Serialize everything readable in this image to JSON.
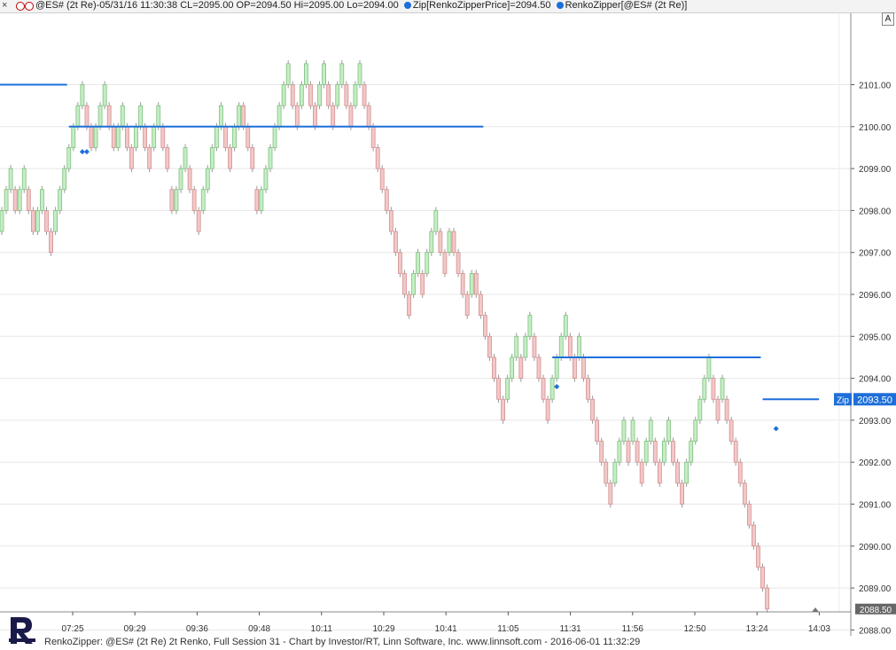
{
  "header": {
    "close_glyph": "×",
    "text": "@ES# (2t Re)-05/31/16 11:30:38 CL=2095.00 OP=2094.50 Hi=2095.00 Lo=2094.00",
    "indicator1": "Zip[RenkoZipperPrice]=2094.50",
    "indicator2": "RenkoZipper[@ES# (2t Re)]"
  },
  "scale_button": "A",
  "footer": {
    "text": "RenkoZipper: @ES# (2t Re) 2t Renko, Full Session 31 - Chart by Investor/RT, Linn Software, Inc. www.linnsoft.com - 2016-06-01 11:32:29"
  },
  "colors": {
    "up_fill": "#c5eec5",
    "up_border": "#7fbf7f",
    "down_fill": "#f2c8c8",
    "down_border": "#d48f8f",
    "zip_line": "#1e6fd9",
    "grid": "#e8e8e8",
    "label_bg": "#1e6fd9"
  },
  "chart_data": {
    "type": "candlestick-renko",
    "brick_size": 0.5,
    "ylim": [
      2087.8,
      2101.5
    ],
    "y_ticks": [
      "2101.00",
      "2100.00",
      "2099.00",
      "2098.00",
      "2097.00",
      "2096.00",
      "2095.00",
      "2094.00",
      "2093.00",
      "2092.00",
      "2091.00",
      "2090.00",
      "2089.00",
      "2088.00"
    ],
    "x_ticks": [
      "07:25",
      "09:29",
      "09:36",
      "09:48",
      "10:11",
      "10:29",
      "10:41",
      "11:05",
      "11:31",
      "11:56",
      "12:50",
      "13:24",
      "14:03"
    ],
    "last_price_label": "2088.50",
    "zip": {
      "name": "Zip",
      "value": "2093.50"
    },
    "bricks": [
      {
        "o": 2097.5,
        "c": 2098.0
      },
      {
        "o": 2098.0,
        "c": 2098.5
      },
      {
        "o": 2098.5,
        "c": 2099.0
      },
      {
        "o": 2098.5,
        "c": 2098.0
      },
      {
        "o": 2098.0,
        "c": 2098.5
      },
      {
        "o": 2098.5,
        "c": 2099.0
      },
      {
        "o": 2098.5,
        "c": 2098.0
      },
      {
        "o": 2098.0,
        "c": 2097.5
      },
      {
        "o": 2097.5,
        "c": 2098.0
      },
      {
        "o": 2098.0,
        "c": 2098.5
      },
      {
        "o": 2098.0,
        "c": 2097.5
      },
      {
        "o": 2097.5,
        "c": 2097.0
      },
      {
        "o": 2097.5,
        "c": 2098.0
      },
      {
        "o": 2098.0,
        "c": 2098.5
      },
      {
        "o": 2098.5,
        "c": 2099.0
      },
      {
        "o": 2099.0,
        "c": 2099.5
      },
      {
        "o": 2099.5,
        "c": 2100.0
      },
      {
        "o": 2100.0,
        "c": 2100.5
      },
      {
        "o": 2100.5,
        "c": 2101.0
      },
      {
        "o": 2100.5,
        "c": 2100.0
      },
      {
        "o": 2100.0,
        "c": 2099.5
      },
      {
        "o": 2099.5,
        "c": 2100.0
      },
      {
        "o": 2100.0,
        "c": 2100.5
      },
      {
        "o": 2100.5,
        "c": 2101.0
      },
      {
        "o": 2100.5,
        "c": 2100.0
      },
      {
        "o": 2100.0,
        "c": 2099.5
      },
      {
        "o": 2099.5,
        "c": 2100.0
      },
      {
        "o": 2100.0,
        "c": 2100.5
      },
      {
        "o": 2100.0,
        "c": 2099.5
      },
      {
        "o": 2099.5,
        "c": 2099.0
      },
      {
        "o": 2099.5,
        "c": 2100.0
      },
      {
        "o": 2100.0,
        "c": 2100.5
      },
      {
        "o": 2100.0,
        "c": 2099.5
      },
      {
        "o": 2099.5,
        "c": 2099.0
      },
      {
        "o": 2099.5,
        "c": 2100.0
      },
      {
        "o": 2100.0,
        "c": 2100.5
      },
      {
        "o": 2100.0,
        "c": 2099.5
      },
      {
        "o": 2099.5,
        "c": 2099.0
      },
      {
        "o": 2098.5,
        "c": 2098.0
      },
      {
        "o": 2098.0,
        "c": 2098.5
      },
      {
        "o": 2098.5,
        "c": 2099.0
      },
      {
        "o": 2099.0,
        "c": 2099.5
      },
      {
        "o": 2099.0,
        "c": 2098.5
      },
      {
        "o": 2098.5,
        "c": 2098.0
      },
      {
        "o": 2098.0,
        "c": 2097.5
      },
      {
        "o": 2098.0,
        "c": 2098.5
      },
      {
        "o": 2098.5,
        "c": 2099.0
      },
      {
        "o": 2099.0,
        "c": 2099.5
      },
      {
        "o": 2099.5,
        "c": 2100.0
      },
      {
        "o": 2100.0,
        "c": 2100.5
      },
      {
        "o": 2100.0,
        "c": 2099.5
      },
      {
        "o": 2099.5,
        "c": 2099.0
      },
      {
        "o": 2099.5,
        "c": 2100.0
      },
      {
        "o": 2100.0,
        "c": 2100.5
      },
      {
        "o": 2100.5,
        "c": 2100.0
      },
      {
        "o": 2100.0,
        "c": 2099.5
      },
      {
        "o": 2099.5,
        "c": 2099.0
      },
      {
        "o": 2098.5,
        "c": 2098.0
      },
      {
        "o": 2098.0,
        "c": 2098.5
      },
      {
        "o": 2098.5,
        "c": 2099.0
      },
      {
        "o": 2099.0,
        "c": 2099.5
      },
      {
        "o": 2099.5,
        "c": 2100.0
      },
      {
        "o": 2100.0,
        "c": 2100.5
      },
      {
        "o": 2100.5,
        "c": 2101.0
      },
      {
        "o": 2101.0,
        "c": 2101.5
      },
      {
        "o": 2101.0,
        "c": 2100.5
      },
      {
        "o": 2100.5,
        "c": 2100.0
      },
      {
        "o": 2100.5,
        "c": 2101.0
      },
      {
        "o": 2101.0,
        "c": 2101.5
      },
      {
        "o": 2101.0,
        "c": 2100.5
      },
      {
        "o": 2100.5,
        "c": 2100.0
      },
      {
        "o": 2100.5,
        "c": 2101.0
      },
      {
        "o": 2101.0,
        "c": 2101.5
      },
      {
        "o": 2101.0,
        "c": 2100.5
      },
      {
        "o": 2100.5,
        "c": 2100.0
      },
      {
        "o": 2100.5,
        "c": 2101.0
      },
      {
        "o": 2101.0,
        "c": 2101.5
      },
      {
        "o": 2101.0,
        "c": 2100.5
      },
      {
        "o": 2100.5,
        "c": 2100.0
      },
      {
        "o": 2100.5,
        "c": 2101.0
      },
      {
        "o": 2101.0,
        "c": 2101.5
      },
      {
        "o": 2101.0,
        "c": 2100.5
      },
      {
        "o": 2100.5,
        "c": 2100.0
      },
      {
        "o": 2100.0,
        "c": 2099.5
      },
      {
        "o": 2099.5,
        "c": 2099.0
      },
      {
        "o": 2099.0,
        "c": 2098.5
      },
      {
        "o": 2098.5,
        "c": 2098.0
      },
      {
        "o": 2098.0,
        "c": 2097.5
      },
      {
        "o": 2097.5,
        "c": 2097.0
      },
      {
        "o": 2097.0,
        "c": 2096.5
      },
      {
        "o": 2096.5,
        "c": 2096.0
      },
      {
        "o": 2096.0,
        "c": 2095.5
      },
      {
        "o": 2096.0,
        "c": 2096.5
      },
      {
        "o": 2096.5,
        "c": 2097.0
      },
      {
        "o": 2096.5,
        "c": 2096.0
      },
      {
        "o": 2096.5,
        "c": 2097.0
      },
      {
        "o": 2097.0,
        "c": 2097.5
      },
      {
        "o": 2097.5,
        "c": 2098.0
      },
      {
        "o": 2097.5,
        "c": 2097.0
      },
      {
        "o": 2097.0,
        "c": 2096.5
      },
      {
        "o": 2097.0,
        "c": 2097.5
      },
      {
        "o": 2097.5,
        "c": 2097.0
      },
      {
        "o": 2097.0,
        "c": 2096.5
      },
      {
        "o": 2096.5,
        "c": 2096.0
      },
      {
        "o": 2096.0,
        "c": 2095.5
      },
      {
        "o": 2096.0,
        "c": 2096.5
      },
      {
        "o": 2096.5,
        "c": 2096.0
      },
      {
        "o": 2096.0,
        "c": 2095.5
      },
      {
        "o": 2095.5,
        "c": 2095.0
      },
      {
        "o": 2095.0,
        "c": 2094.5
      },
      {
        "o": 2094.5,
        "c": 2094.0
      },
      {
        "o": 2094.0,
        "c": 2093.5
      },
      {
        "o": 2093.5,
        "c": 2093.0
      },
      {
        "o": 2093.5,
        "c": 2094.0
      },
      {
        "o": 2094.0,
        "c": 2094.5
      },
      {
        "o": 2094.5,
        "c": 2095.0
      },
      {
        "o": 2094.5,
        "c": 2094.0
      },
      {
        "o": 2094.5,
        "c": 2095.0
      },
      {
        "o": 2095.0,
        "c": 2095.5
      },
      {
        "o": 2095.0,
        "c": 2094.5
      },
      {
        "o": 2094.5,
        "c": 2094.0
      },
      {
        "o": 2094.0,
        "c": 2093.5
      },
      {
        "o": 2093.5,
        "c": 2093.0
      },
      {
        "o": 2093.5,
        "c": 2094.0
      },
      {
        "o": 2094.0,
        "c": 2094.5
      },
      {
        "o": 2094.5,
        "c": 2095.0
      },
      {
        "o": 2095.0,
        "c": 2095.5
      },
      {
        "o": 2095.0,
        "c": 2094.5
      },
      {
        "o": 2094.5,
        "c": 2094.0
      },
      {
        "o": 2094.5,
        "c": 2095.0
      },
      {
        "o": 2094.5,
        "c": 2094.0
      },
      {
        "o": 2094.0,
        "c": 2093.5
      },
      {
        "o": 2093.5,
        "c": 2093.0
      },
      {
        "o": 2093.0,
        "c": 2092.5
      },
      {
        "o": 2092.5,
        "c": 2092.0
      },
      {
        "o": 2092.0,
        "c": 2091.5
      },
      {
        "o": 2091.5,
        "c": 2091.0
      },
      {
        "o": 2091.5,
        "c": 2092.0
      },
      {
        "o": 2092.0,
        "c": 2092.5
      },
      {
        "o": 2092.5,
        "c": 2093.0
      },
      {
        "o": 2092.5,
        "c": 2092.0
      },
      {
        "o": 2092.5,
        "c": 2093.0
      },
      {
        "o": 2092.5,
        "c": 2092.0
      },
      {
        "o": 2092.0,
        "c": 2091.5
      },
      {
        "o": 2092.0,
        "c": 2092.5
      },
      {
        "o": 2092.5,
        "c": 2093.0
      },
      {
        "o": 2092.5,
        "c": 2092.0
      },
      {
        "o": 2092.0,
        "c": 2091.5
      },
      {
        "o": 2092.0,
        "c": 2092.5
      },
      {
        "o": 2092.5,
        "c": 2093.0
      },
      {
        "o": 2092.5,
        "c": 2092.0
      },
      {
        "o": 2092.0,
        "c": 2091.5
      },
      {
        "o": 2091.5,
        "c": 2091.0
      },
      {
        "o": 2091.5,
        "c": 2092.0
      },
      {
        "o": 2092.0,
        "c": 2092.5
      },
      {
        "o": 2092.5,
        "c": 2093.0
      },
      {
        "o": 2093.0,
        "c": 2093.5
      },
      {
        "o": 2093.5,
        "c": 2094.0
      },
      {
        "o": 2094.0,
        "c": 2094.5
      },
      {
        "o": 2094.0,
        "c": 2093.5
      },
      {
        "o": 2093.5,
        "c": 2093.0
      },
      {
        "o": 2093.5,
        "c": 2094.0
      },
      {
        "o": 2093.5,
        "c": 2093.0
      },
      {
        "o": 2093.0,
        "c": 2092.5
      },
      {
        "o": 2092.5,
        "c": 2092.0
      },
      {
        "o": 2092.0,
        "c": 2091.5
      },
      {
        "o": 2091.5,
        "c": 2091.0
      },
      {
        "o": 2091.0,
        "c": 2090.5
      },
      {
        "o": 2090.5,
        "c": 2090.0
      },
      {
        "o": 2090.0,
        "c": 2089.5
      },
      {
        "o": 2089.5,
        "c": 2089.0
      },
      {
        "o": 2089.0,
        "c": 2088.5
      }
    ],
    "zip_segments": [
      {
        "from": 0,
        "to": 14,
        "value": 2101.0
      },
      {
        "from": 15,
        "to": 107,
        "value": 2100.0
      },
      {
        "from": 123,
        "to": 169,
        "value": 2094.5
      },
      {
        "from": 170,
        "to": 182,
        "value": 2093.5
      }
    ],
    "signals": [
      {
        "at": 18,
        "value": 2099.4
      },
      {
        "at": 19,
        "value": 2099.4
      },
      {
        "at": 124,
        "value": 2093.8
      },
      {
        "at": 173,
        "value": 2092.8
      }
    ]
  }
}
